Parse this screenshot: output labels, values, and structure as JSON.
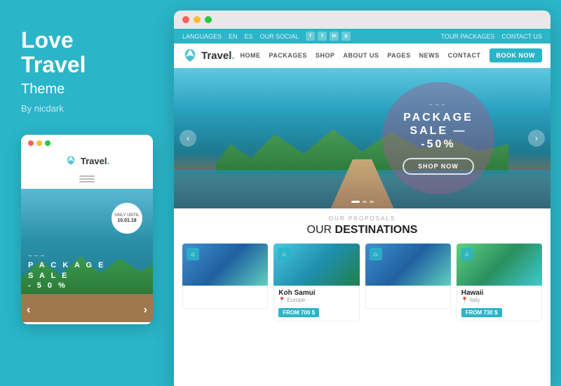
{
  "left": {
    "title_line1": "Love",
    "title_line2": "Travel",
    "subtitle": "Theme",
    "author": "By nicdark"
  },
  "mobile": {
    "logo_text": "Travel",
    "only_until_label": "ONLY UNTIL",
    "only_until_date": "10.01.18",
    "wave": "~~~",
    "pkg_line1": "P A C K A G E",
    "pkg_line2": "S A L E",
    "pkg_line3": "- 5 0 %",
    "arrow_left": "‹",
    "arrow_right": "›"
  },
  "topbar": {
    "languages": "LANGUAGES",
    "lang_en": "EN",
    "lang_es": "ES",
    "our_social": "OUR SOCIAL",
    "tour_packages": "TOUR PACKAGES",
    "contact_us": "CONTACT US"
  },
  "navbar": {
    "logo_text": "Travel",
    "links": [
      "HOME",
      "PACKAGES",
      "SHOP",
      "ABOUT US",
      "PAGES",
      "NEWS",
      "CONTACT"
    ],
    "book_btn": "BOOK NOW"
  },
  "hero": {
    "wave": "~~~",
    "pkg_line1": "PACKAGE",
    "pkg_line2": "SALE —",
    "pkg_line3": "-50%",
    "shop_now": "SHOP NOW",
    "arrow_left": "‹",
    "arrow_right": "›"
  },
  "destinations": {
    "section_label": "OUR PROPOSALS",
    "title_prefix": "OUR ",
    "title_bold": "DESTINATIONS",
    "cards": [
      {
        "name": "",
        "location": "",
        "location_icon": "📍",
        "price": "",
        "img_class": "img-third"
      },
      {
        "name": "Koh Samui",
        "location": "Europe",
        "location_icon": "📍",
        "price": "FROM 700 $",
        "img_class": "img-koh"
      },
      {
        "name": "",
        "location": "",
        "location_icon": "📍",
        "price": "",
        "img_class": "img-third"
      },
      {
        "name": "Hawaii",
        "location": "Italy",
        "location_icon": "📍",
        "price": "FROM 730 $",
        "img_class": "img-hawaii"
      }
    ]
  }
}
